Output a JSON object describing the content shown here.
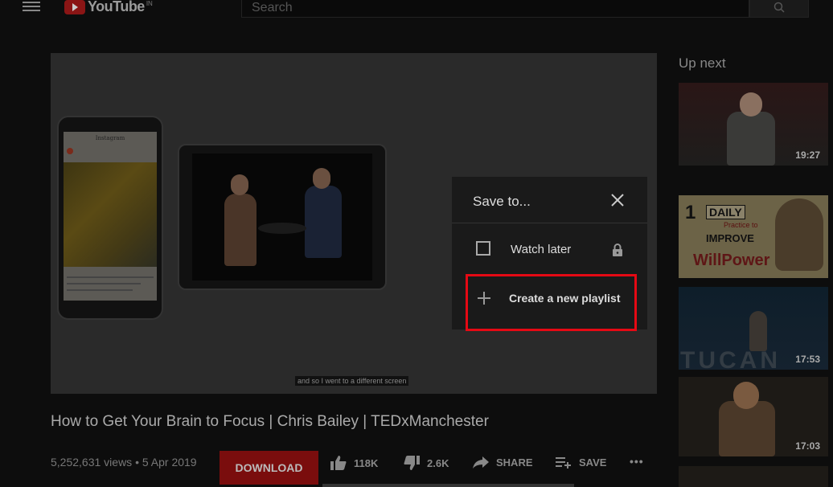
{
  "header": {
    "logo_text": "YouTube",
    "logo_region": "IN",
    "search_placeholder": "Search"
  },
  "player": {
    "caption": "and so I went to a different screen",
    "phone_app_label": "Instagram"
  },
  "save_dialog": {
    "title": "Save to...",
    "watch_later_label": "Watch later",
    "create_playlist_label": "Create a new playlist"
  },
  "video": {
    "title": "How to Get Your Brain to Focus | Chris Bailey | TEDxManchester",
    "views_date": "5,252,631 views • 5 Apr 2019",
    "download_label": "DOWNLOAD",
    "likes": "118K",
    "dislikes": "2.6K",
    "share_label": "SHARE",
    "save_label": "SAVE",
    "more_label": "•••"
  },
  "sidebar": {
    "heading": "Up next",
    "thumbs": [
      {
        "duration": "19:27"
      },
      {
        "text_number": "1",
        "text_daily": "DAILY",
        "text_practice": "Practice to",
        "text_improve": "IMPROVE",
        "text_will": "WillPower"
      },
      {
        "duration": "17:53",
        "logo_text": "TUCAN"
      },
      {
        "duration": "17:03"
      }
    ]
  },
  "colors": {
    "background": "#0d0d0d",
    "highlight_box": "#e50914",
    "download_button": "#7a0d0d"
  }
}
